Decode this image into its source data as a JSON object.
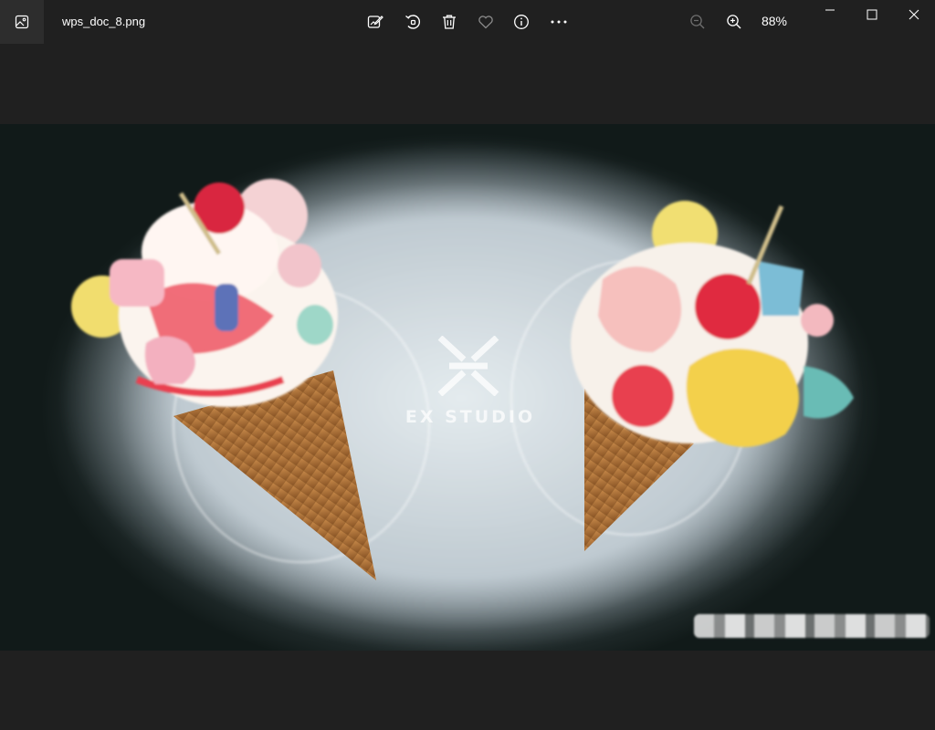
{
  "window": {
    "filename": "wps_doc_8.png",
    "app_icon": "photos-app-icon"
  },
  "toolbar": {
    "buttons": [
      {
        "name": "edit-image-icon"
      },
      {
        "name": "rotate-icon"
      },
      {
        "name": "delete-icon"
      },
      {
        "name": "favorite-icon"
      },
      {
        "name": "info-icon"
      },
      {
        "name": "more-options-icon"
      }
    ],
    "zoom_out_icon": "zoom-out-icon",
    "zoom_in_icon": "zoom-in-icon",
    "zoom_level": "88%"
  },
  "window_controls": {
    "minimize_icon": "minimize-icon",
    "maximize_icon": "maximize-icon",
    "close_icon": "close-icon"
  },
  "photo": {
    "watermark_text": "EX STUDIO",
    "colors": {
      "background": "#202020",
      "titlebar": "#202020",
      "app_icon_bg": "#2d2d2d",
      "disabled_icon": "#6e6e6e"
    }
  }
}
